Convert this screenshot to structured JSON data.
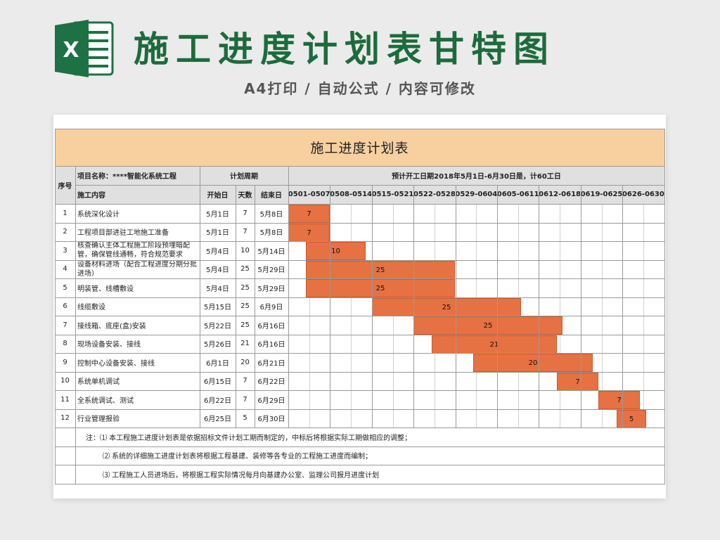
{
  "banner": {
    "title": "施工进度计划表甘特图",
    "subtitle": "A4打印 / 自动公式 / 内容可修改",
    "icon_letter": "X",
    "colors": {
      "title": "#1d6b3d",
      "icon": "#1e7145"
    }
  },
  "sheet": {
    "title": "施工进度计划表",
    "headers": {
      "seq": "序号",
      "project_name": "项目名称：****智能化系统工程",
      "content": "施工内容",
      "plan_period": "计划周期",
      "start": "开始日",
      "days": "天数",
      "end": "结束日",
      "schedule": "预计开工日期2018年5月1日-6月30日是，计60工日"
    },
    "weeks": [
      "0501-0507",
      "0508-0514",
      "0515-0521",
      "0522-0528",
      "0529-0604",
      "0605-0611",
      "0612-0618",
      "0619-0625",
      "0626-0630"
    ],
    "tasks": [
      {
        "no": "1",
        "name": "系统深化设计",
        "start": "5月1日",
        "days": "7",
        "end": "5月8日",
        "bar_start_day": 0,
        "bar_label": "7"
      },
      {
        "no": "2",
        "name": "工程项目部进驻工地施工准备",
        "start": "5月1日",
        "days": "7",
        "end": "5月8日",
        "bar_start_day": 0,
        "bar_label": "7"
      },
      {
        "no": "3",
        "name": "核查确认主体工程施工阶段预埋暗配管，确保管线通畅，符合规范要求",
        "start": "5月4日",
        "days": "10",
        "end": "5月14日",
        "bar_start_day": 3,
        "bar_label": "10"
      },
      {
        "no": "4",
        "name": "设备材料进场（配合工程进度分期分批进场）",
        "start": "5月4日",
        "days": "25",
        "end": "5月29日",
        "bar_start_day": 3,
        "bar_label": "25"
      },
      {
        "no": "5",
        "name": "明装管、线槽敷设",
        "start": "5月4日",
        "days": "25",
        "end": "5月29日",
        "bar_start_day": 3,
        "bar_label": "25"
      },
      {
        "no": "6",
        "name": "线缆敷设",
        "start": "5月15日",
        "days": "25",
        "end": "6月9日",
        "bar_start_day": 14,
        "bar_label": "25"
      },
      {
        "no": "7",
        "name": "接线箱、底座(盒)安装",
        "start": "5月22日",
        "days": "25",
        "end": "6月16日",
        "bar_start_day": 21,
        "bar_label": "25"
      },
      {
        "no": "8",
        "name": "现场设备安装、接线",
        "start": "5月26日",
        "days": "21",
        "end": "6月16日",
        "bar_start_day": 24,
        "bar_label": "21"
      },
      {
        "no": "9",
        "name": "控制中心设备安装、接线",
        "start": "6月1日",
        "days": "20",
        "end": "6月21日",
        "bar_start_day": 31,
        "bar_label": "20"
      },
      {
        "no": "10",
        "name": "系统单机调试",
        "start": "6月15日",
        "days": "7",
        "end": "6月22日",
        "bar_start_day": 45,
        "bar_label": "7"
      },
      {
        "no": "11",
        "name": "全系统调试、测试",
        "start": "6月22日",
        "days": "7",
        "end": "6月29日",
        "bar_start_day": 52,
        "bar_label": "7"
      },
      {
        "no": "12",
        "name": "行业管理报验",
        "start": "6月25日",
        "days": "5",
        "end": "6月30日",
        "bar_start_day": 55,
        "bar_label": "5"
      }
    ],
    "notes": [
      "注：⑴ 本工程施工进度计划表是依据招标文件计划工期而制定的，中标后将根据实际工期做相应的调整；",
      "⑵ 系统的详细施工进度计划表将根据工程基建、装修等各专业的工程施工进度而编制；",
      "⑶ 工程施工人员进场后，将根据工程实际情况每月向基建办公室、监理公司报月进度计划"
    ],
    "colors": {
      "title_bg": "#f8cf9f",
      "header_bg": "#e0e0e0",
      "bar": "#e67143"
    }
  }
}
